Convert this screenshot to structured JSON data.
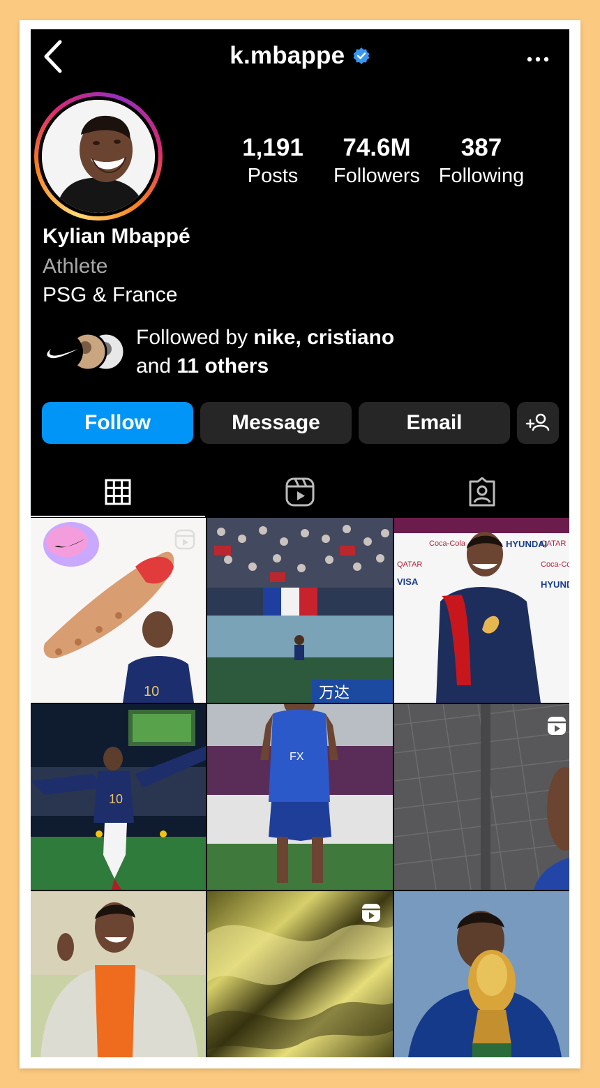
{
  "header": {
    "username": "k.mbappe",
    "verified": true,
    "back_icon": "chevron-left-icon",
    "more_icon": "more-horizontal-icon"
  },
  "profile": {
    "display_name": "Kylian Mbappé",
    "category": "Athlete",
    "bio": "PSG & France",
    "stats": [
      {
        "value": "1,191",
        "label": "Posts"
      },
      {
        "value": "74.6M",
        "label": "Followers"
      },
      {
        "value": "387",
        "label": "Following"
      }
    ],
    "followed_by": {
      "prefix": "Followed by ",
      "names": "nike, cristiano",
      "middle": "and ",
      "others": "11 others"
    }
  },
  "actions": {
    "follow": "Follow",
    "message": "Message",
    "email": "Email",
    "add_user_icon": "add-person-icon"
  },
  "tabs": [
    {
      "name": "posts-grid",
      "icon": "grid-icon",
      "active": true
    },
    {
      "name": "reels",
      "icon": "reels-icon",
      "active": false
    },
    {
      "name": "tagged",
      "icon": "tagged-icon",
      "active": false
    }
  ],
  "colors": {
    "accent": "#0095f6",
    "secondary_button": "#262626",
    "muted_text": "#a8a8a8",
    "verified": "#3897f0"
  }
}
